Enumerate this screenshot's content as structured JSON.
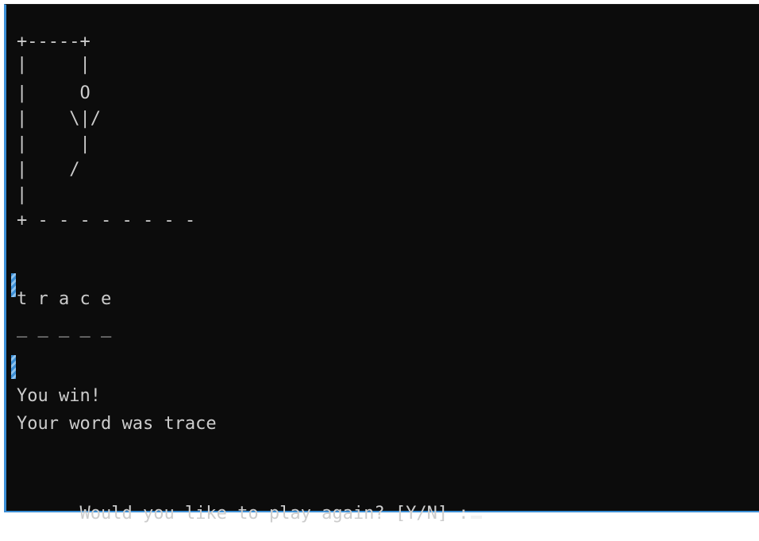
{
  "terminal": {
    "gallows": [
      "+-----+",
      "|     |",
      "|     O",
      "|    \\|/",
      "|     |",
      "|    /",
      "|",
      "+ - - - - - - - -"
    ],
    "guessed_word": "t r a c e",
    "word_blanks": "_ _ _ _ _",
    "result_message": "You win!",
    "word_reveal": "Your word was trace",
    "prompt": "Would you like to play again? [Y/N] :"
  },
  "colors": {
    "background": "#0c0c0c",
    "text": "#cccccc",
    "accent": "#3c8fd6"
  }
}
